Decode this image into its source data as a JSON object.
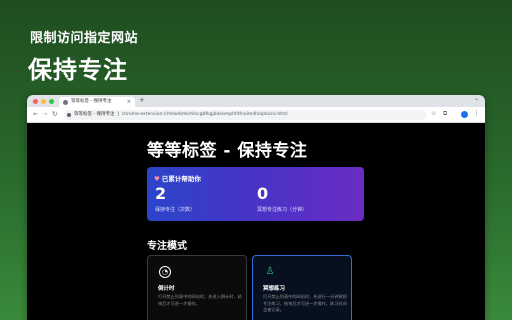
{
  "promo": {
    "subtitle": "限制访问指定网站",
    "title": "保持专注"
  },
  "browser": {
    "tab_title": "等等标签 - 保持专注",
    "tab_close": "×",
    "new_tab": "+",
    "tabbar_menu": "⌄",
    "nav": {
      "back": "←",
      "forward": "→",
      "reload": "↻"
    },
    "omnibox_site": "等等标签 - 保持专注",
    "omnibox_url": "chrome-extension://mkkebmkmlkcgbfkgjbdeomphfdfnoimdh/options.html",
    "star": "☆",
    "extensions": "⧉",
    "menu": "⋮"
  },
  "page": {
    "title": "等等标签 - 保持专注",
    "stats": {
      "header_icon": "♥",
      "header": "已累计帮助你",
      "focus_count": "2",
      "focus_label": "保持专注（次数）",
      "meditation_count": "0",
      "meditation_label": "冥想专注练习（分钟）"
    },
    "section_title": "专注模式",
    "modes": [
      {
        "name": "倒计时",
        "icon": "timer-icon",
        "icon_glyph": "◔",
        "desc": "打开禁止列表中的网站时，先进入倒计时，结束后才可进一步操作。"
      },
      {
        "name": "冥想练习",
        "icon": "meditation-icon",
        "icon_glyph": "♙",
        "desc": "打开禁止列表中的网站时，先进行一分钟冥想专注练习，结束后才可进一步操作，练习时间会被记录。"
      }
    ]
  },
  "colors": {
    "bg_top": "#1f4d20",
    "bg_bottom": "#3a8a3b",
    "card_gradient_start": "#2b44c9",
    "card_gradient_end": "#6a2cc4",
    "selected_border": "#2f6fd6",
    "meditation_accent": "#34c27a"
  }
}
